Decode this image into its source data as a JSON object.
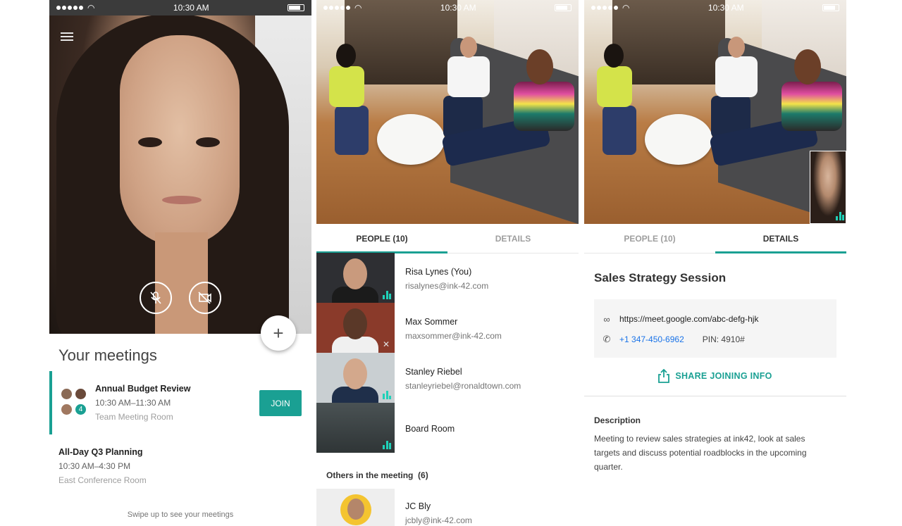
{
  "status_bar": {
    "time": "10:30 AM"
  },
  "colors": {
    "accent": "#1aa093",
    "link": "#1a73e8"
  },
  "screen1": {
    "controls": {
      "mic_icon": "mic-off-icon",
      "camera_icon": "videocam-off-icon",
      "fab_label": "+"
    },
    "meetings_title": "Your meetings",
    "meetings": [
      {
        "title": "Annual Budget Review",
        "time": "10:30 AM–11:30 AM",
        "room": "Team Meeting Room",
        "join_label": "JOIN",
        "avatar_badge": "4"
      },
      {
        "title": "All-Day Q3 Planning",
        "time": "10:30 AM–4:30 PM",
        "room": "East Conference Room"
      }
    ],
    "swipe_hint": "Swipe up to see your meetings"
  },
  "screen2": {
    "tabs": {
      "people": "PEOPLE (10)",
      "details": "DETAILS"
    },
    "people": [
      {
        "name": "Risa Lynes (You)",
        "email": "risalynes@ink-42.com"
      },
      {
        "name": "Max Sommer",
        "email": "maxsommer@ink-42.com"
      },
      {
        "name": "Stanley Riebel",
        "email": "stanleyriebel@ronaldtown.com"
      },
      {
        "name": "Board Room",
        "email": ""
      }
    ],
    "others_label": "Others in the meeting",
    "others_count": "(6)",
    "others": [
      {
        "name": "JC Bly",
        "email": "jcbly@ink-42.com"
      }
    ]
  },
  "screen3": {
    "tabs": {
      "people": "PEOPLE (10)",
      "details": "DETAILS"
    },
    "meeting_title": "Sales Strategy Session",
    "link": "https://meet.google.com/abc-defg-hjk",
    "phone": "+1 347-450-6962",
    "pin": "PIN: 4910#",
    "share_label": "SHARE JOINING INFO",
    "description_heading": "Description",
    "description": "Meeting to review sales strategies at ink42, look at sales targets and discuss potential roadblocks in the upcoming quarter."
  }
}
